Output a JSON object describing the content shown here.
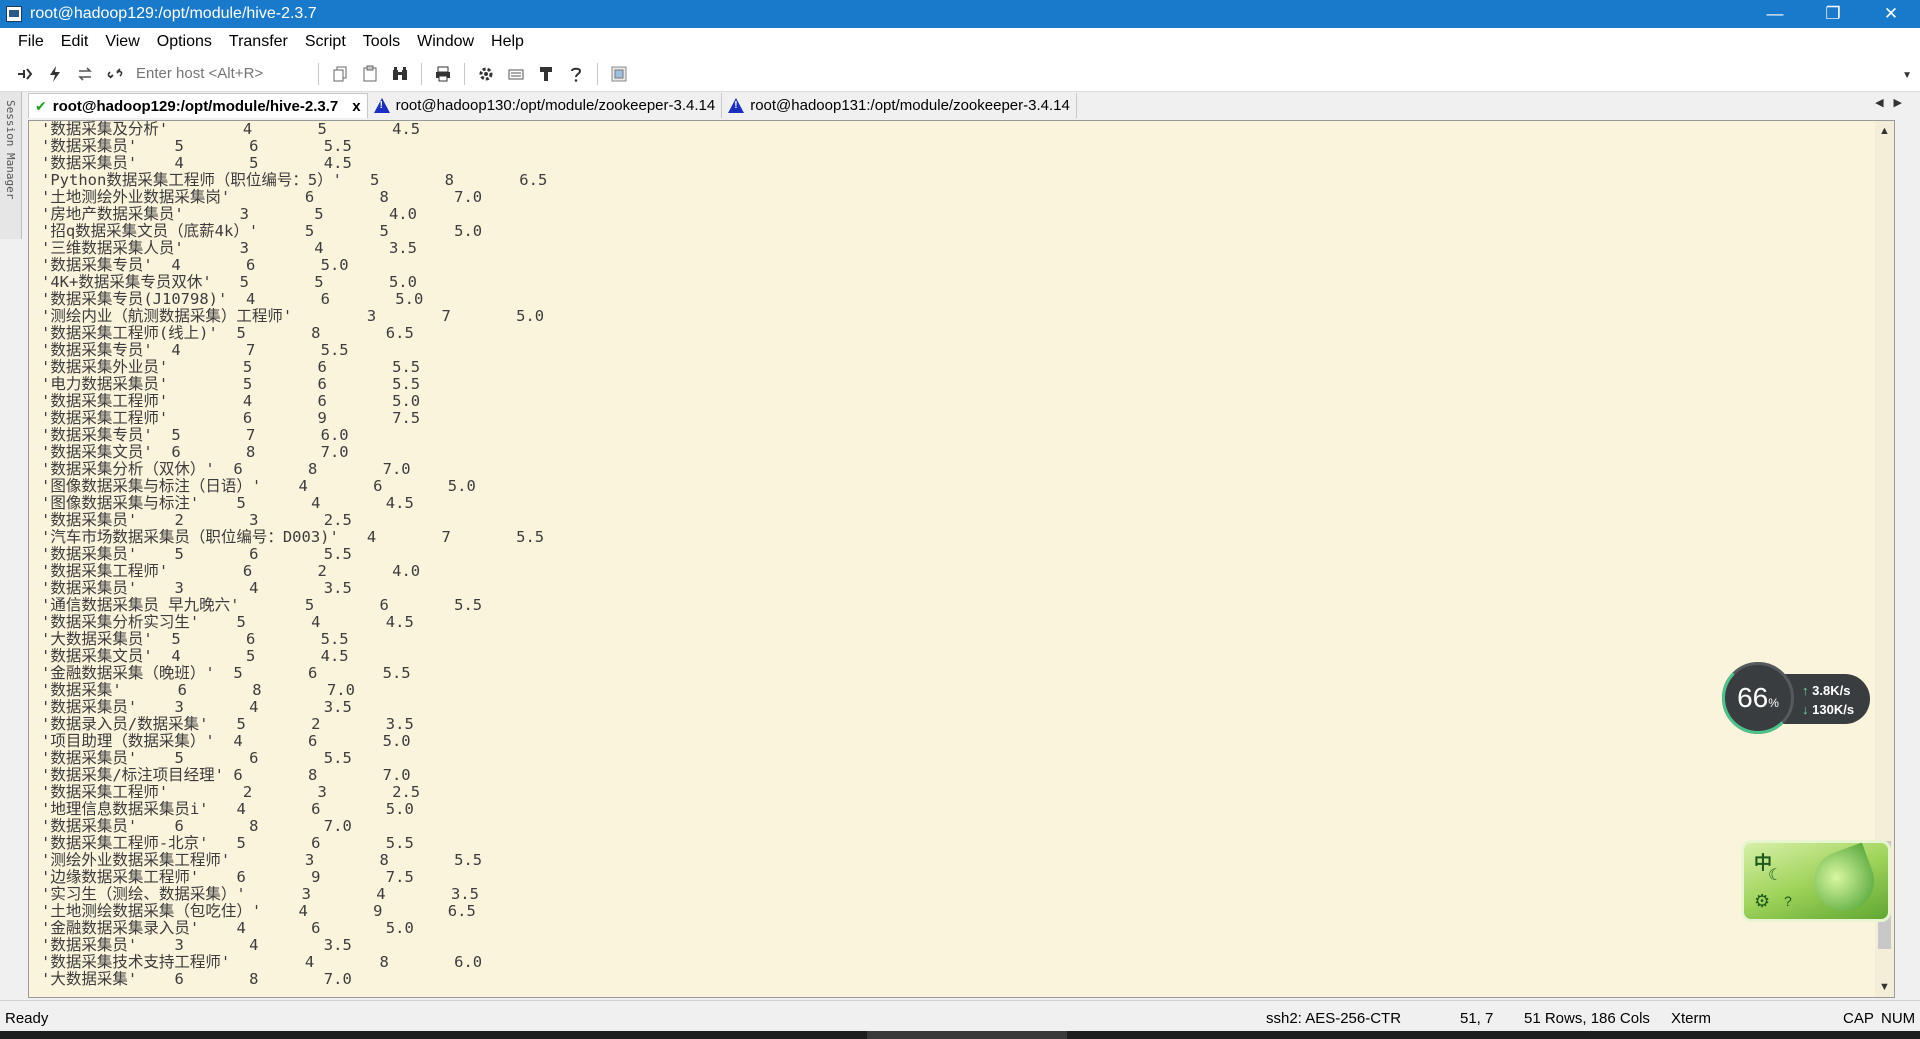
{
  "window": {
    "title": "root@hadoop129:/opt/module/hive-2.3.7",
    "minimize": "—",
    "restore": "❐",
    "close": "✕"
  },
  "menu": [
    "File",
    "Edit",
    "View",
    "Options",
    "Transfer",
    "Script",
    "Tools",
    "Window",
    "Help"
  ],
  "toolbar": {
    "host_placeholder": "Enter host <Alt+R>"
  },
  "session_manager": "Session Manager",
  "tabs": [
    {
      "label": "root@hadoop129:/opt/module/hive-2.3.7",
      "status": "connected",
      "active": true,
      "close": "x"
    },
    {
      "label": "root@hadoop130:/opt/module/zookeeper-3.4.14",
      "status": "disconnected",
      "active": false
    },
    {
      "label": "root@hadoop131:/opt/module/zookeeper-3.4.14",
      "status": "disconnected",
      "active": false
    }
  ],
  "terminal": {
    "lines": [
      "'数据采集及分析'        4       5       4.5",
      "'数据采集员'    5       6       5.5",
      "'数据采集员'    4       5       4.5",
      "'Python数据采集工程师（职位编号：5）'   5       8       6.5",
      "'土地测绘外业数据采集岗'        6       8       7.0",
      "'房地产数据采集员'      3       5       4.0",
      "'招q数据采集文员（底薪4k）'     5       5       5.0",
      "'三维数据采集人员'      3       4       3.5",
      "'数据采集专员'  4       6       5.0",
      "'4K+数据采集专员双休'   5       5       5.0",
      "'数据采集专员(J10798)'  4       6       5.0",
      "'测绘内业（航测数据采集）工程师'        3       7       5.0",
      "'数据采集工程师(线上)'  5       8       6.5",
      "'数据采集专员'  4       7       5.5",
      "'数据采集外业员'        5       6       5.5",
      "'电力数据采集员'        5       6       5.5",
      "'数据采集工程师'        4       6       5.0",
      "'数据采集工程师'        6       9       7.5",
      "'数据采集专员'  5       7       6.0",
      "'数据采集文员'  6       8       7.0",
      "'数据采集分析（双休）'  6       8       7.0",
      "'图像数据采集与标注（日语）'    4       6       5.0",
      "'图像数据采集与标注'    5       4       4.5",
      "'数据采集员'    2       3       2.5",
      "'汽车市场数据采集员（职位编号：D003)'   4       7       5.5",
      "'数据采集员'    5       6       5.5",
      "'数据采集工程师'        6       2       4.0",
      "'数据采集员'    3       4       3.5",
      "'通信数据采集员 早九晚六'       5       6       5.5",
      "'数据采集分析实习生'    5       4       4.5",
      "'大数据采集员'  5       6       5.5",
      "'数据采集文员'  4       5       4.5",
      "'金融数据采集（晚班）'  5       6       5.5",
      "'数据采集'      6       8       7.0",
      "'数据采集员'    3       4       3.5",
      "'数据录入员/数据采集'   5       2       3.5",
      "'项目助理（数据采集）'  4       6       5.0",
      "'数据采集员'    5       6       5.5",
      "'数据采集/标注项目经理' 6       8       7.0",
      "'数据采集工程师'        2       3       2.5",
      "'地理信息数据采集员i'   4       6       5.0",
      "'数据采集员'    6       8       7.0",
      "'数据采集工程师-北京'   5       6       5.5",
      "'测绘外业数据采集工程师'        3       8       5.5",
      "'边缘数据采集工程师'    6       9       7.5",
      "'实习生（测绘、数据采集）'      3       4       3.5",
      "'土地测绘数据采集（包吃住）'    4       9       6.5",
      "'金融数据采集录入员'    4       6       5.0",
      "'数据采集员'    3       4       3.5",
      "'数据采集技术支持工程师'        4       8       6.0",
      "'大数据采集'    6       8       7.0"
    ]
  },
  "status": {
    "ready": "Ready",
    "cipher": "ssh2: AES-256-CTR",
    "cursor": "51,  7",
    "size": "51 Rows, 186 Cols",
    "term": "Xterm",
    "caps": "CAP",
    "num": "NUM"
  },
  "netmon": {
    "percent": "66",
    "percent_unit": "%",
    "upload": "3.8K/s",
    "download": "130K/s"
  },
  "ime": {
    "mode": "中",
    "moon": "☾",
    "gear": "⚙",
    "key": "?"
  }
}
